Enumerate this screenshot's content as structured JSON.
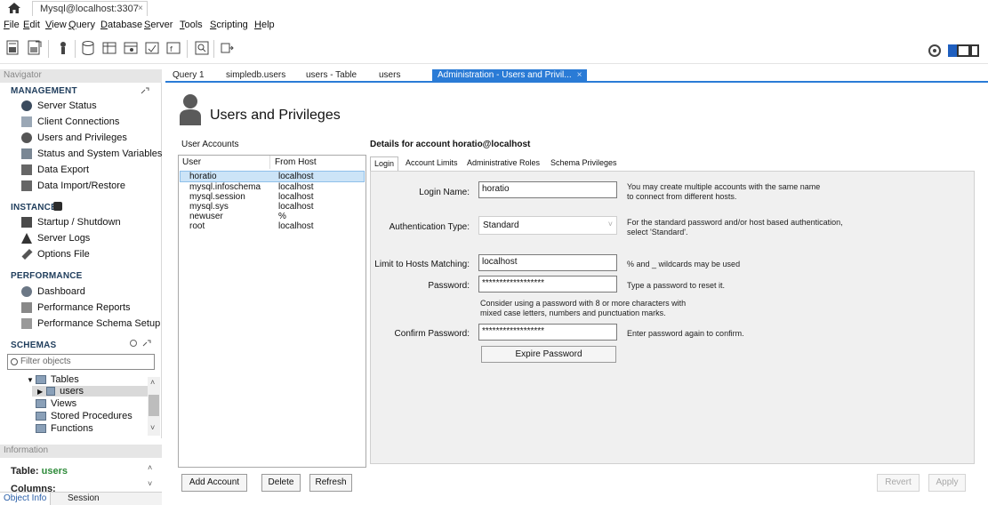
{
  "window": {
    "connection_tab": "Mysql@localhost:3307",
    "connection_tab_close": "×"
  },
  "menu": {
    "file": "ile",
    "file_key": "F",
    "edit": "dit",
    "edit_key": "E",
    "view": "iew",
    "view_key": "V",
    "query": "uery",
    "query_key": "Q",
    "database": "atabase",
    "database_key": "D",
    "server": "erver",
    "server_key": "S",
    "tools": "ools",
    "tools_key": "T",
    "scripting": "cripting",
    "scripting_key": "S",
    "help": "elp",
    "help_key": "H"
  },
  "navigator": {
    "header": "Navigator",
    "management": {
      "title": "MANAGEMENT",
      "items": [
        "Server Status",
        "Client Connections",
        "Users and Privileges",
        "Status and System Variables",
        "Data Export",
        "Data Import/Restore"
      ]
    },
    "instance": {
      "title": "INSTANCE",
      "items": [
        "Startup / Shutdown",
        "Server Logs",
        "Options File"
      ]
    },
    "performance": {
      "title": "PERFORMANCE",
      "items": [
        "Dashboard",
        "Performance Reports",
        "Performance Schema Setup"
      ]
    },
    "schemas": {
      "title": "SCHEMAS",
      "filter_placeholder": "Filter objects",
      "tree": [
        "Tables",
        "users",
        "Views",
        "Stored Procedures",
        "Functions"
      ]
    }
  },
  "info": {
    "header": "Information",
    "table_label": "Table:",
    "table_name": "users",
    "columns_label": "Columns:",
    "tabs": [
      "Object Info",
      "Session"
    ]
  },
  "editor_tabs": {
    "items": [
      "Query 1",
      "simpledb.users",
      "users - Table",
      "users"
    ],
    "active": "Administration - Users and Privil...",
    "active_close": "×"
  },
  "page": {
    "title": "Users and Privileges",
    "accounts_label": "User Accounts",
    "columns": [
      "User",
      "From Host"
    ],
    "users": [
      {
        "user": "horatio",
        "host": "localhost"
      },
      {
        "user": "mysql.infoschema",
        "host": "localhost"
      },
      {
        "user": "mysql.session",
        "host": "localhost"
      },
      {
        "user": "mysql.sys",
        "host": "localhost"
      },
      {
        "user": "newuser",
        "host": "%"
      },
      {
        "user": "root",
        "host": "localhost"
      }
    ],
    "buttons": {
      "add": "Add Account",
      "delete": "Delete",
      "refresh": "Refresh",
      "revert": "Revert",
      "apply": "Apply"
    }
  },
  "details": {
    "heading": "Details for account horatio@localhost",
    "tabs": [
      "Login",
      "Account Limits",
      "Administrative Roles",
      "Schema Privileges"
    ],
    "login_name_label": "Login Name:",
    "login_name": "horatio",
    "login_name_hint": "You may create multiple accounts with the same name\nto connect from different hosts.",
    "auth_type_label": "Authentication Type:",
    "auth_type": "Standard",
    "auth_hint": "For the standard password and/or host based authentication,\nselect 'Standard'.",
    "hosts_label": "Limit to Hosts Matching:",
    "hosts": "localhost",
    "hosts_hint": "% and _ wildcards may be used",
    "password_label": "Password:",
    "password": "******************",
    "password_hint": "Type a password to reset it.",
    "password_advice": "Consider using a password with 8 or more characters with\nmixed case letters, numbers and punctuation marks.",
    "confirm_label": "Confirm Password:",
    "confirm": "******************",
    "confirm_hint": "Enter password again to confirm.",
    "expire_button": "Expire Password"
  },
  "colors": {
    "accent": "#2a7bd6",
    "selection": "#cce4f7",
    "table_name": "#2e8b3a",
    "section": "#1f3d5c"
  }
}
